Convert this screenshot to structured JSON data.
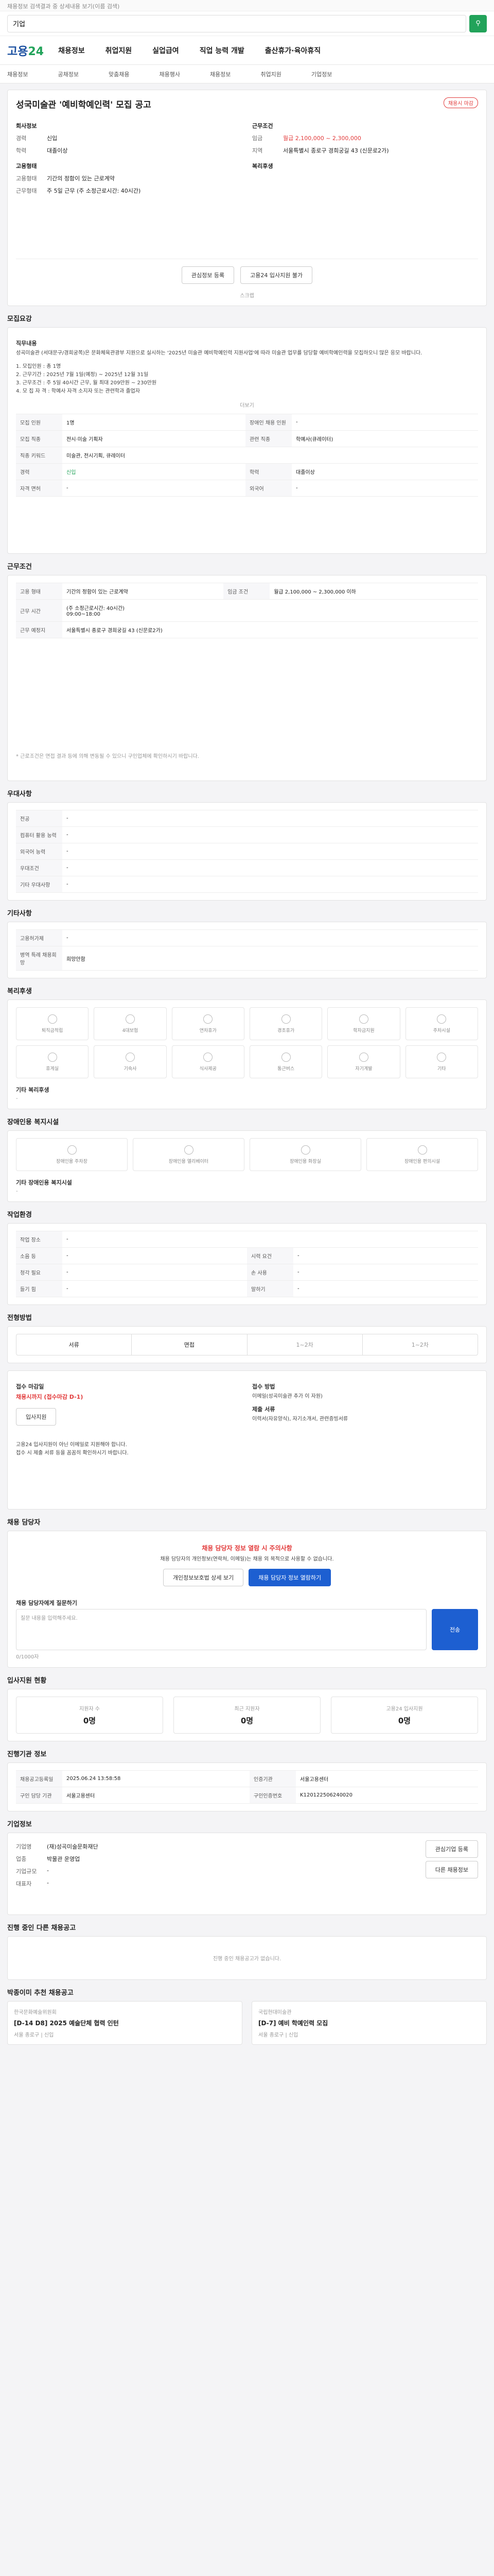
{
  "top_notice": "채용정보 검색결과 중 상세내용 보기(이름 검색)",
  "search": {
    "placeholder": "",
    "value": "기업"
  },
  "logo": {
    "part1": "고용",
    "part2": "24"
  },
  "gnb": [
    "채용정보",
    "취업지원",
    "실업급여",
    "직업 능력 개발",
    "출산휴가·육아휴직"
  ],
  "subnav": [
    "채용정보",
    "공채정보",
    "맞춤채용",
    "채용행사",
    "채용정보",
    "취업지원",
    "기업정보"
  ],
  "job": {
    "title": "성국미술관 '예비학예인력' 모집 공고",
    "badge": "채용시 마감",
    "company_label": "회사정보",
    "conditions_label": "근무조건",
    "left": [
      {
        "k": "경력",
        "v": "신입"
      },
      {
        "k": "학력",
        "v": "대졸이상"
      }
    ],
    "right": [
      {
        "k": "임금",
        "v": "월급 2,100,000 ~ 2,300,000"
      },
      {
        "k": "지역",
        "v": "서울특별시 종로구 경희궁길 43 (신문로2가)"
      }
    ],
    "employ_label": "고용형태",
    "employ": [
      {
        "k": "고용형태",
        "v": "기간의 정함이 있는 근로계약"
      },
      {
        "k": "근무형태",
        "v": "주 5일 근무 (주 소정근로시간: 40시간)"
      }
    ],
    "welfare_label": "복리후생",
    "btn_interest": "관심정보 등록",
    "btn_apply": "고용24 입사지원 불가",
    "scrap_label": "스크랩"
  },
  "recruit": {
    "title": "모집요강",
    "duty_label": "직무내용",
    "duty_text": "성곡미술관 (서대문구/경희궁쪽)은 문화체육관광부 지원으로 실시하는 '2025년 미술관 예비학예인력 지원사업'에 따라 미술관 업무를 담당할 예비학예인력을 모집하오니 많은 응모 바랍니다.",
    "period_text": "1. 모집인원 : 총 1명\n2. 근무기간 : 2025년 7월 1일(예정) ~ 2025년 12월 31일\n3. 근무조건 : 주 5일 40시간 근무, 월 최대 209만원 ~ 230만원\n4. 모 집 자 격 : 학예사 자격 소지자 또는 관련학과 졸업자",
    "more": "더보기",
    "table": [
      [
        "모집 인원",
        "1명",
        "장애인 채용 인원",
        "-"
      ],
      [
        "모집 직종",
        "전시·미술 기획자",
        "관련 직종",
        "학예사(큐레이터)"
      ],
      [
        "직종 키워드",
        "미술관, 전시기획, 큐레이터",
        "",
        ""
      ],
      [
        "경력",
        "신입",
        "학력",
        "대졸이상"
      ],
      [
        "자격 면허",
        "-",
        "외국어",
        "-"
      ]
    ]
  },
  "work": {
    "title": "근무조건",
    "rows": [
      [
        "고용 형태",
        "기간의 정함이 있는 근로계약",
        "임금 조건",
        "월급 2,100,000 ~ 2,300,000 이하"
      ],
      [
        "근무 시간",
        "(주 소정근로시간: 40시간)",
        "",
        ""
      ],
      [
        "근무 예정지",
        "서울특별시 종로구 경희궁길 43 (신문로2가)",
        "",
        ""
      ]
    ],
    "time_detail": "09:00~18:00",
    "note": "* 근로조건은 면접 결과 등에 의해 변동될 수 있으니 구인업체에 확인하시기 바랍니다."
  },
  "prefer": {
    "title": "우대사항",
    "rows": [
      "전공",
      "컴퓨터 활용 능력",
      "외국어 능력",
      "우대조건",
      "기타 우대사항"
    ]
  },
  "apply_method": {
    "title": "기타사항",
    "rows": [
      [
        "고용허가제",
        "-"
      ],
      [
        "병역 특례 채용희망",
        "희망안함"
      ]
    ]
  },
  "welfare": {
    "title": "복리후생",
    "items": [
      "퇴직금적립",
      "4대보험",
      "연차휴가",
      "경조휴가",
      "학자금지원",
      "주차시설",
      "휴게실",
      "기숙사",
      "식사제공",
      "통근버스",
      "자기계발",
      "기타"
    ],
    "other_label": "기타 복리후생"
  },
  "disability": {
    "title": "장애인용 복지시설",
    "items": [
      "장애인용 주차장",
      "장애인용 엘리베이터",
      "장애인용 화장실",
      "장애인용 편의시설"
    ],
    "other_label": "기타 장애인용 복지시설"
  },
  "workplace": {
    "title": "작업환경",
    "rows": [
      [
        "작업 장소",
        "-",
        "",
        ""
      ],
      [
        "소음 등",
        "-",
        "시력 요건",
        "-"
      ],
      [
        "청각 필요",
        "-",
        "손 사용",
        "-"
      ],
      [
        "들기 힘",
        "-",
        "말하기",
        "-"
      ]
    ]
  },
  "process": {
    "title": "전형방법",
    "tabs": [
      "서류",
      "면접",
      "1~2차",
      "1~2차"
    ]
  },
  "receipt": {
    "title": "접수 마감일",
    "deadline": "채용시까지 (접수마감 D-1)",
    "method_label": "접수 방법",
    "method": "이메일(성곡미술관 추가 이 자원)",
    "submit_label": "제출 서류",
    "submit": "이력서(자유양식), 자기소개서, 관련증빙서류",
    "notes": [
      "고용24 입사지원이 아닌 이메일로 지원해야 합니다.",
      "접수 시 제출 서류 등을 꼼꼼히 확인하시기 바랍니다."
    ],
    "apply_btn": "입사지원"
  },
  "hr": {
    "title": "채용 담당자",
    "warn": "채용 담당자 정보 열람 시 주의사항",
    "warn_text": "채용 담당자의 개인정보(연락처, 이메일)는 채용 외 목적으로 사용할 수 없습니다.",
    "btn1": "개인정보보호법 상세 보기",
    "btn2": "채용 담당자 정보 열람하기",
    "question_label": "채용 담당자에게 질문하기",
    "question_placeholder": "질문 내용을 입력해주세요.",
    "send": "전송",
    "counter": "0/1000자"
  },
  "status": {
    "title": "입사지원 현황",
    "cells": [
      {
        "k": "지원자 수",
        "v": "0명"
      },
      {
        "k": "최근 지원자",
        "v": "0명"
      },
      {
        "k": "고용24 입사지원",
        "v": "0명"
      }
    ]
  },
  "info": {
    "title": "진행기관 정보",
    "rows": [
      [
        "채용공고등록일",
        "2025.06.24 13:58:58",
        "인증기관",
        "서울고용센터"
      ],
      [
        "구인 담당 기관",
        "서울고용센터",
        "구인인증번호",
        "K120122506240020"
      ]
    ]
  },
  "company": {
    "title": "기업정보",
    "rows": [
      [
        "기업명",
        "(재)성곡미술문화재단"
      ],
      [
        "업종",
        "박물관 운영업"
      ],
      [
        "기업규모",
        "-"
      ],
      [
        "대표자",
        "-"
      ]
    ],
    "btn_follow": "관심기업 등록",
    "btn_more": "다른 채용정보"
  },
  "similar": {
    "title": "진행 중인 다른 채용공고",
    "empty": "진행 중인 채용공고가 없습니다."
  },
  "recommend": {
    "title": "박종이미 추천 채용공고",
    "cards": [
      {
        "company": "한국문화예술위원회",
        "title": "[D-14 D8] 2025 예술단체 협력 인턴",
        "meta": "서울 종로구 | 신입"
      },
      {
        "company": "국립현대미술관",
        "title": "[D-7] 예비 학예인력 모집",
        "meta": "서울 종로구 | 신입"
      }
    ]
  }
}
